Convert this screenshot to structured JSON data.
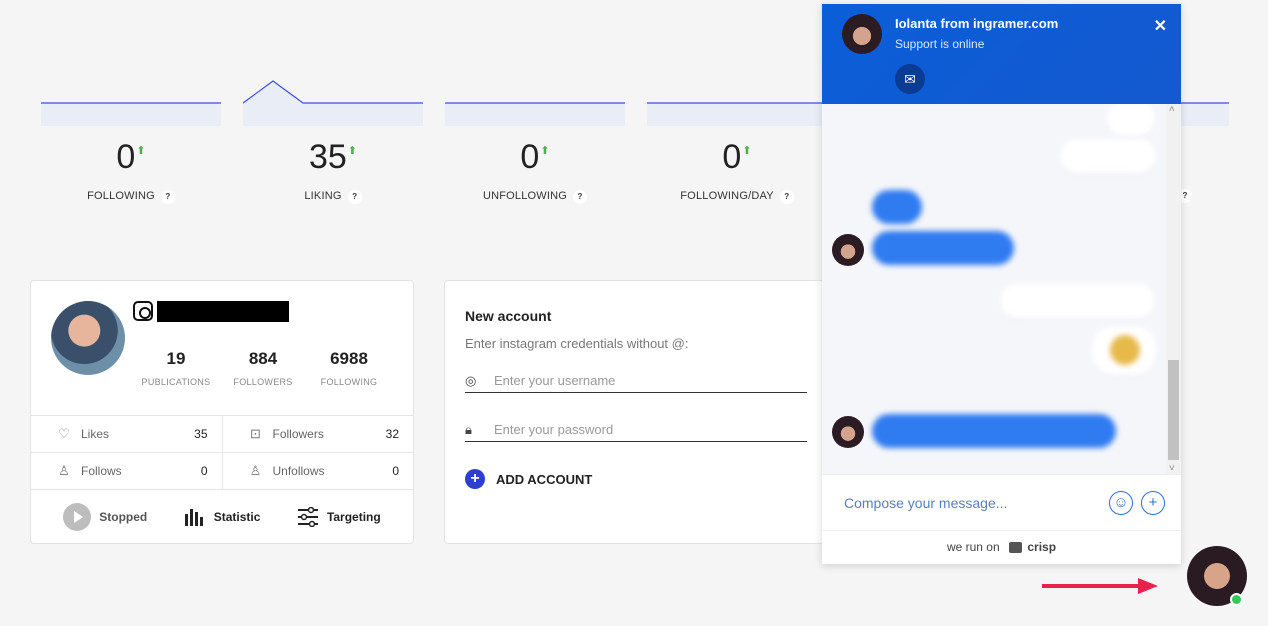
{
  "stats": [
    {
      "value": "0",
      "label": "FOLLOWING",
      "help": "?"
    },
    {
      "value": "35",
      "label": "LIKING",
      "help": "?"
    },
    {
      "value": "0",
      "label": "UNFOLLOWING",
      "help": "?"
    },
    {
      "value": "0",
      "label": "FOLLOWING/DAY",
      "help": "?"
    }
  ],
  "hidden_stat_help": "?",
  "profile": {
    "publications": {
      "value": "19",
      "label": "PUBLICATIONS"
    },
    "followers": {
      "value": "884",
      "label": "FOLLOWERS"
    },
    "following": {
      "value": "6988",
      "label": "FOLLOWING"
    },
    "grid": {
      "likes": {
        "label": "Likes",
        "value": "35"
      },
      "followers": {
        "label": "Followers",
        "value": "32"
      },
      "follows": {
        "label": "Follows",
        "value": "0"
      },
      "unfollows": {
        "label": "Unfollows",
        "value": "0"
      }
    },
    "actions": {
      "stopped": "Stopped",
      "statistic": "Statistic",
      "targeting": "Targeting"
    }
  },
  "new_account": {
    "title": "New account",
    "subtitle": "Enter instagram credentials without @:",
    "username_placeholder": "Enter your username",
    "password_placeholder": "Enter your password",
    "add_label": "ADD ACCOUNT"
  },
  "chat": {
    "operator_name": "Iolanta from ingramer.com",
    "operator_status": "Support is online",
    "close_glyph": "✕",
    "mail_glyph": "✉",
    "compose_placeholder": "Compose your message...",
    "emoji_glyph": "☺",
    "add_glyph": "+",
    "footer_prefix": "we run on",
    "footer_brand": "crisp",
    "scroll_up_glyph": "˄",
    "scroll_down_glyph": "˅"
  },
  "colors": {
    "accent": "#2c3fd0",
    "chat_header": "#0a5ed8",
    "online": "#34c759",
    "arrow": "#e8224f",
    "sparkline": "#3b4fd8"
  }
}
